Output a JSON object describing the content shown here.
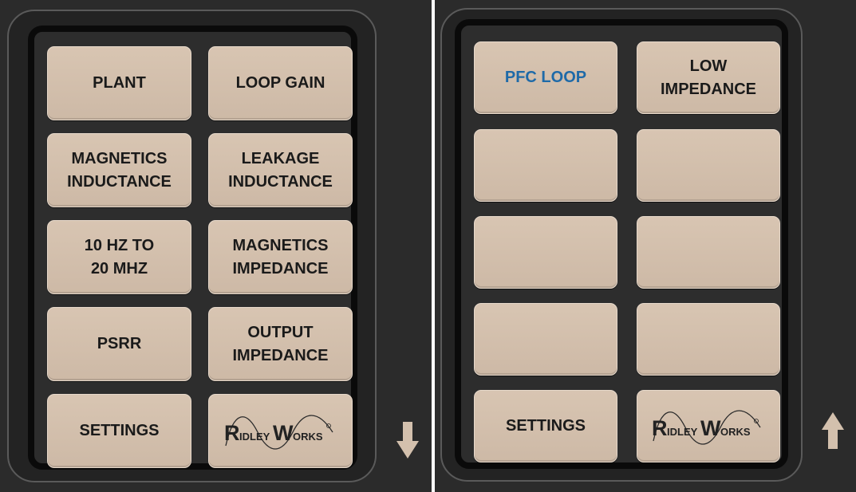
{
  "left_panel": {
    "buttons": [
      {
        "label": "PLANT"
      },
      {
        "label": "LOOP GAIN"
      },
      {
        "label": "MAGNETICS\nINDUCTANCE"
      },
      {
        "label": "LEAKAGE\nINDUCTANCE"
      },
      {
        "label": "10 HZ TO\n20 MHZ"
      },
      {
        "label": "MAGNETICS\nIMPEDANCE"
      },
      {
        "label": "PSRR"
      },
      {
        "label": "OUTPUT\nIMPEDANCE"
      },
      {
        "label": "SETTINGS"
      }
    ],
    "logo_text": "RidleyWorks",
    "arrow": "down-arrow-icon"
  },
  "right_panel": {
    "buttons": [
      {
        "label": "PFC LOOP"
      },
      {
        "label": "LOW\nIMPEDANCE"
      },
      {
        "label": ""
      },
      {
        "label": ""
      },
      {
        "label": ""
      },
      {
        "label": ""
      },
      {
        "label": ""
      },
      {
        "label": ""
      },
      {
        "label": "SETTINGS"
      }
    ],
    "logo_text": "RidleyWorks",
    "arrow": "up-arrow-icon"
  },
  "colors": {
    "button": "#d3c0ad",
    "highlight_text": "#1e6aa8",
    "arrow": "#d3c0ad",
    "background": "#2b2b2b"
  }
}
